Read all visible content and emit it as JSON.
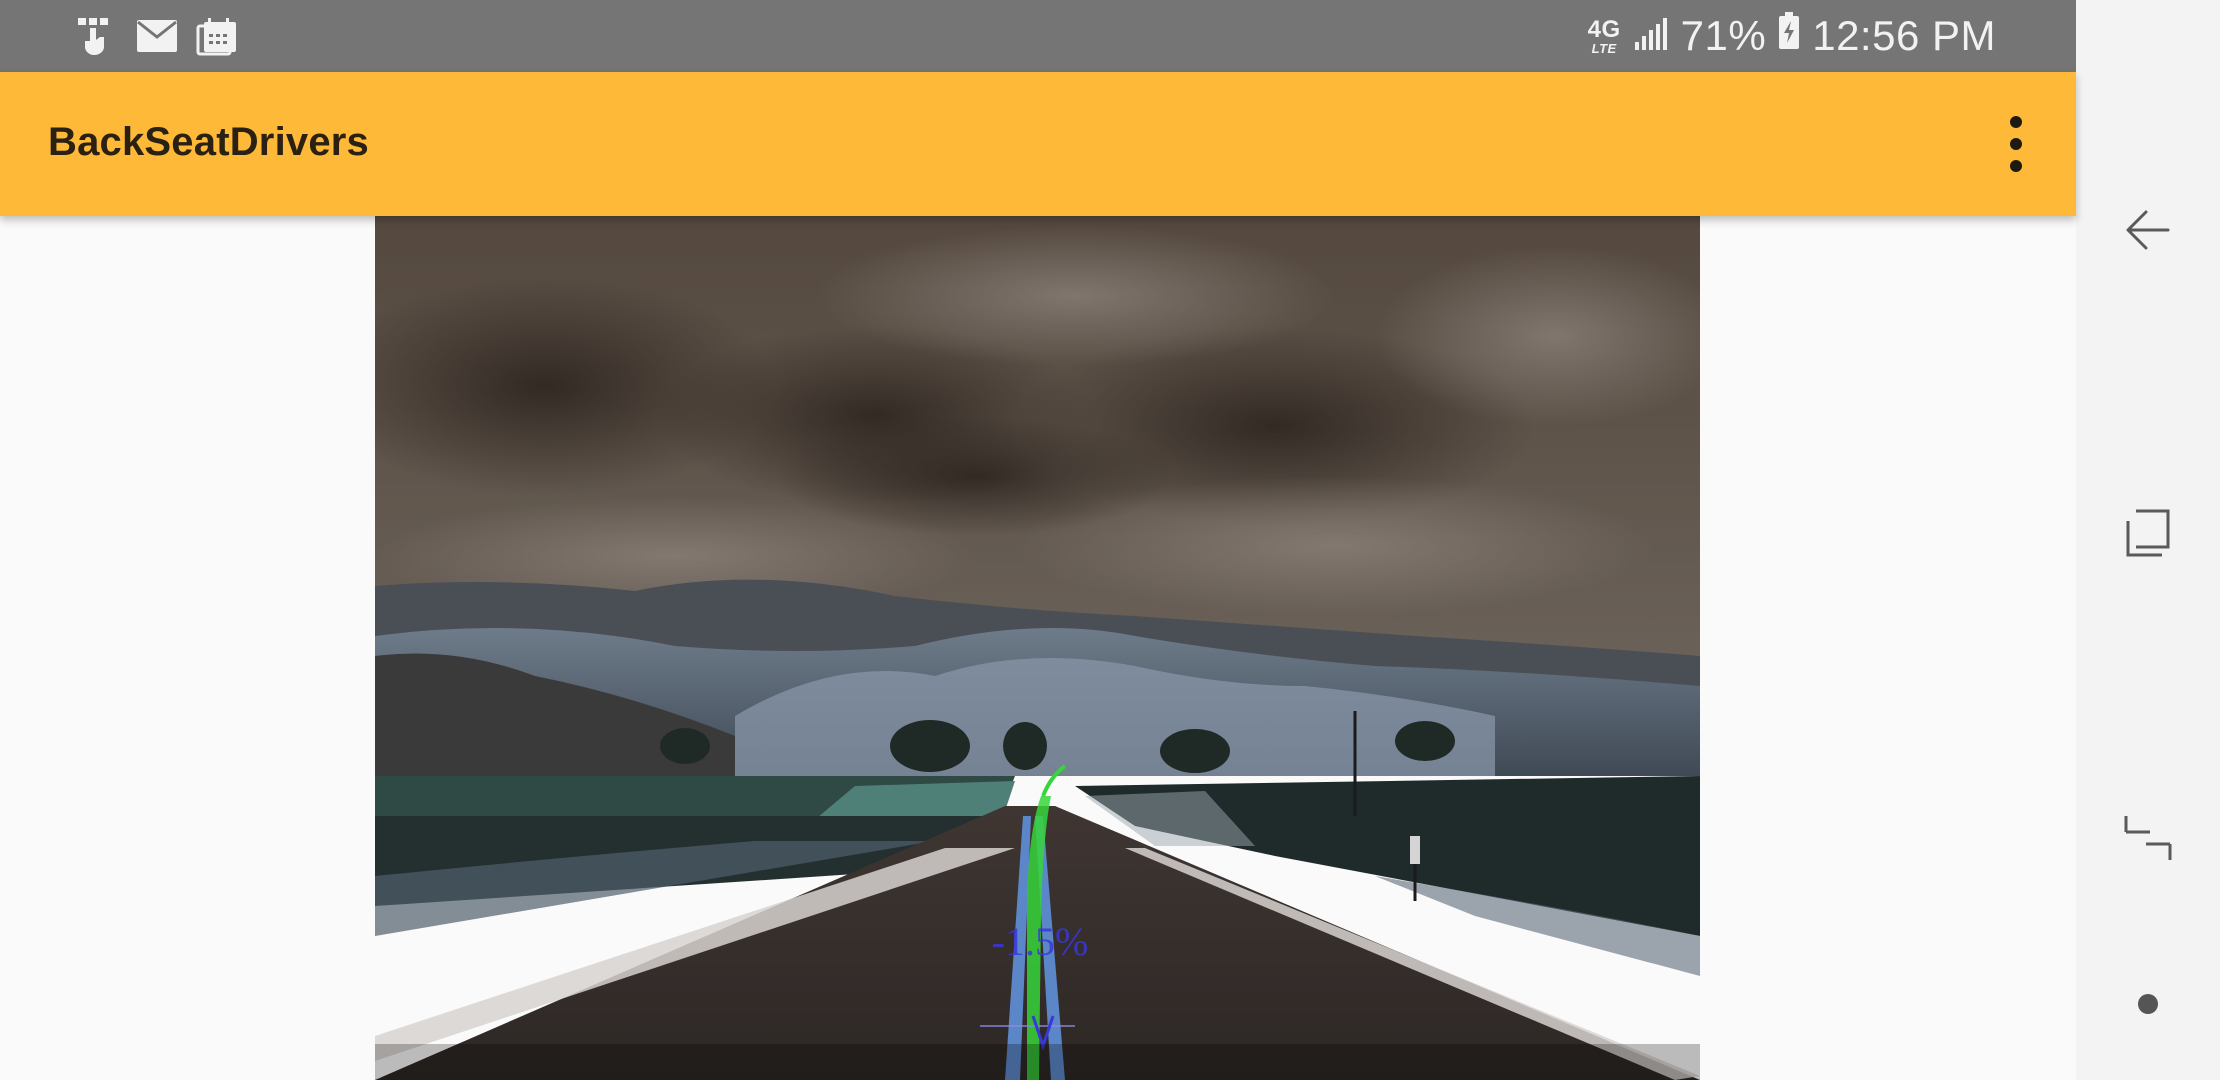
{
  "status_bar": {
    "notification_icons": [
      "tmobile-icon",
      "mail-icon",
      "calendar-icon"
    ],
    "network": {
      "top": "4G",
      "bottom": "LTE"
    },
    "signal_icon": "signal-bars-icon",
    "battery_percent": "71%",
    "battery_icon": "battery-charging-icon",
    "time": "12:56 PM"
  },
  "app_bar": {
    "title": "BackSeatDrivers",
    "menu_icon": "more-vert-icon"
  },
  "camera_view": {
    "grade_text": "-1.5%",
    "lane_overlay_color": "#36d53a",
    "grade_text_color": "#3a37d8"
  },
  "nav_bar": {
    "back_icon": "back-icon",
    "recents_icon": "recents-icon",
    "home_icon": "home-icon"
  },
  "colors": {
    "status_bar_bg": "#757575",
    "app_bar_bg": "#ffb938",
    "content_bg": "#fafafa",
    "nav_bar_bg": "#f3f3f3"
  }
}
